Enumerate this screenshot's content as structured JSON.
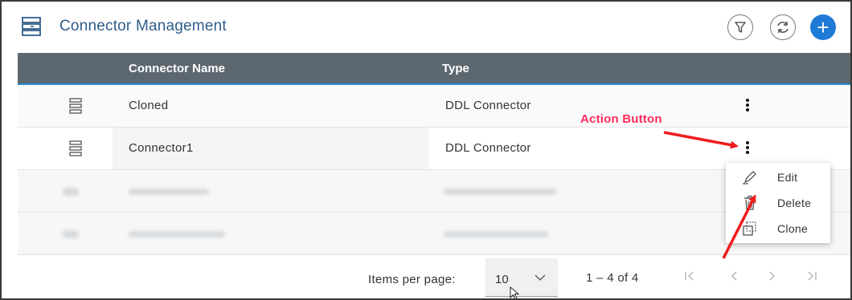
{
  "header": {
    "title": "Connector Management",
    "icon": "connector-stack-icon",
    "buttons": {
      "filter_icon": "filter-icon",
      "refresh_icon": "refresh-icon",
      "add_label": "+"
    }
  },
  "table": {
    "columns": [
      "",
      "Connector Name",
      "Type",
      ""
    ],
    "rows": [
      {
        "icon": "connector-stack-icon",
        "name": "Cloned",
        "type": "DDL Connector",
        "action_icon": "kebab-menu-icon"
      },
      {
        "icon": "connector-stack-icon",
        "name": "Connector1",
        "type": "DDL Connector",
        "action_icon": "kebab-menu-icon"
      }
    ]
  },
  "action_menu": {
    "items": [
      {
        "label": "Edit",
        "icon": "pencil-icon"
      },
      {
        "label": "Delete",
        "icon": "trash-icon"
      },
      {
        "label": "Clone",
        "icon": "clone-icon"
      }
    ]
  },
  "annotation": {
    "label": "Action Button",
    "color": "#ff2a5c"
  },
  "pagination": {
    "items_per_page_label": "Items per page:",
    "items_per_page_value": "10",
    "range": "1 – 4 of 4",
    "first_label": "|<",
    "prev_label": "<",
    "next_label": ">",
    "last_label": ">|"
  },
  "colors": {
    "header_title": "#2f5d8a",
    "table_header_bg": "#5d6770",
    "accent_blue": "#1f7ad6",
    "annotation_red": "#ff2a5c"
  }
}
